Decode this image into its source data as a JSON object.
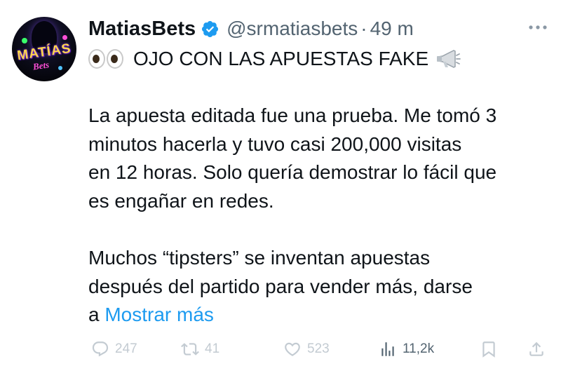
{
  "tweet": {
    "author": {
      "display_name": "MatiasBets",
      "handle": "@srmatiasbets",
      "separator": "·",
      "time": "49 m",
      "avatar_text": "MATÍAS",
      "avatar_subtext": "Bets"
    },
    "headline": "OJO CON LAS APUESTAS FAKE",
    "body_lines_1": [
      "La apuesta editada fue una prueba. Me tomó 3",
      "minutos hacerla y tuvo casi 200,000 visitas",
      "en 12 horas. Solo quería demostrar lo fácil que",
      "es engañar en redes."
    ],
    "body_lines_2": [
      "Muchos “tipsters” se inventan apuestas",
      "después del partido para vender más, darse"
    ],
    "last_line_prefix": "a",
    "show_more": "Mostrar más",
    "metrics": {
      "replies": "247",
      "retweets": "41",
      "likes": "523",
      "views": "11,2k"
    }
  },
  "colors": {
    "link": "#1d9bf0",
    "verified": "#1d9bf0",
    "secondary_text": "#536471",
    "faded_icons": "#c3cbd2"
  },
  "icons": [
    "verified-badge-icon",
    "more-icon",
    "eyes-emoji-icon",
    "megaphone-icon",
    "reply-icon",
    "retweet-icon",
    "like-icon",
    "views-icon",
    "bookmark-icon",
    "share-icon"
  ]
}
